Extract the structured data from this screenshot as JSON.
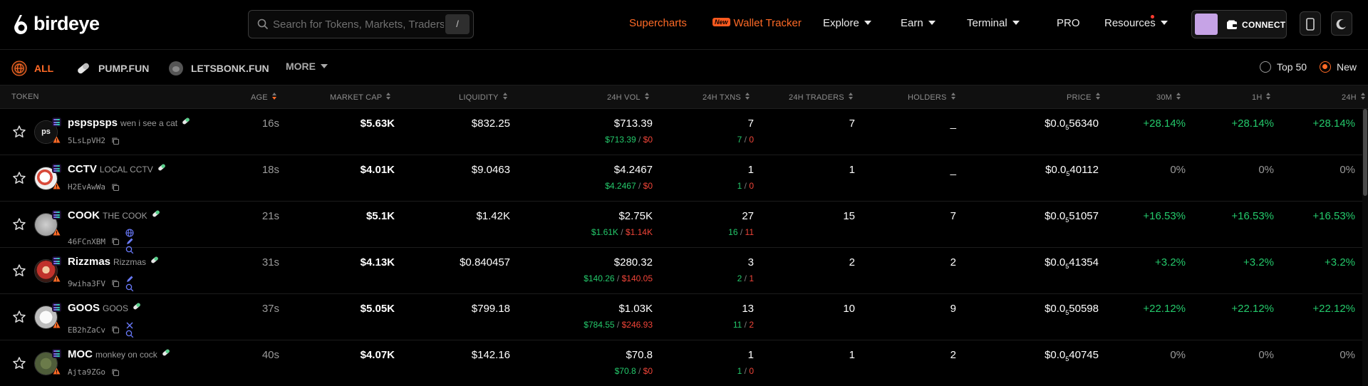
{
  "app": {
    "name": "birdeye"
  },
  "search": {
    "placeholder": "Search for Tokens, Markets, Traders...",
    "shortcut": "/"
  },
  "nav": {
    "supercharts": "Supercharts",
    "wallet_tracker_badge": "New",
    "wallet_tracker": "Wallet Tracker",
    "explore": "Explore",
    "earn": "Earn",
    "terminal": "Terminal",
    "pro": "PRO",
    "resources": "Resources",
    "connect": "CONNECT"
  },
  "filters": {
    "tabs": [
      {
        "label": "ALL",
        "active": true
      },
      {
        "label": "PUMP.FUN",
        "active": false
      },
      {
        "label": "LETSBONK.FUN",
        "active": false
      }
    ],
    "more": "MORE",
    "radio": [
      {
        "label": "Top 50",
        "selected": false
      },
      {
        "label": "New",
        "selected": true
      }
    ]
  },
  "colors": {
    "accent": "#ff6a26",
    "positive": "#24c96b",
    "negative": "#f04438"
  },
  "table": {
    "headers": {
      "token": "TOKEN",
      "age": "AGE",
      "market_cap": "MARKET CAP",
      "liquidity": "LIQUIDITY",
      "vol": "24H VOL",
      "txns": "24H TXNS",
      "traders": "24H TRADERS",
      "holders": "HOLDERS",
      "price": "PRICE",
      "m30": "30M",
      "h1": "1H",
      "h24": "24H"
    },
    "rows": [
      {
        "symbol": "pspspsps",
        "name": "wen i see a cat",
        "address": "5LsLpVH2",
        "age": "16s",
        "market_cap": "$5.63K",
        "liquidity": "$832.25",
        "vol": "$713.39",
        "vol_buy": "$713.39",
        "vol_sell": "$0",
        "txns": "7",
        "txns_buy": "7",
        "txns_sell": "0",
        "traders": "7",
        "holders": "_",
        "price_prefix": "$0.0",
        "price_zeros": "5",
        "price_digits": "56340",
        "m30": "+28.14%",
        "h1": "+28.14%",
        "h24": "+28.14%",
        "change_color": "positive"
      },
      {
        "symbol": "CCTV",
        "name": "LOCAL CCTV",
        "address": "H2EvAwWa",
        "age": "18s",
        "market_cap": "$4.01K",
        "liquidity": "$9.0463",
        "vol": "$4.2467",
        "vol_buy": "$4.2467",
        "vol_sell": "$0",
        "txns": "1",
        "txns_buy": "1",
        "txns_sell": "0",
        "traders": "1",
        "holders": "_",
        "price_prefix": "$0.0",
        "price_zeros": "5",
        "price_digits": "40112",
        "m30": "0%",
        "h1": "0%",
        "h24": "0%",
        "change_color": "neutral"
      },
      {
        "symbol": "COOK",
        "name": "THE COOK",
        "address": "46FCnXBM",
        "age": "21s",
        "market_cap": "$5.1K",
        "liquidity": "$1.42K",
        "vol": "$2.75K",
        "vol_buy": "$1.61K",
        "vol_sell": "$1.14K",
        "txns": "27",
        "txns_buy": "16",
        "txns_sell": "11",
        "traders": "15",
        "holders": "7",
        "price_prefix": "$0.0",
        "price_zeros": "5",
        "price_digits": "51057",
        "m30": "+16.53%",
        "h1": "+16.53%",
        "h24": "+16.53%",
        "change_color": "positive"
      },
      {
        "symbol": "Rizzmas",
        "name": "Rizzmas",
        "address": "9wiha3FV",
        "age": "31s",
        "market_cap": "$4.13K",
        "liquidity": "$0.840457",
        "vol": "$280.32",
        "vol_buy": "$140.26",
        "vol_sell": "$140.05",
        "txns": "3",
        "txns_buy": "2",
        "txns_sell": "1",
        "traders": "2",
        "holders": "2",
        "price_prefix": "$0.0",
        "price_zeros": "5",
        "price_digits": "41354",
        "m30": "+3.2%",
        "h1": "+3.2%",
        "h24": "+3.2%",
        "change_color": "positive"
      },
      {
        "symbol": "GOOS",
        "name": "GOOS",
        "address": "EB2hZaCv",
        "age": "37s",
        "market_cap": "$5.05K",
        "liquidity": "$799.18",
        "vol": "$1.03K",
        "vol_buy": "$784.55",
        "vol_sell": "$246.93",
        "txns": "13",
        "txns_buy": "11",
        "txns_sell": "2",
        "traders": "10",
        "holders": "9",
        "price_prefix": "$0.0",
        "price_zeros": "5",
        "price_digits": "50598",
        "m30": "+22.12%",
        "h1": "+22.12%",
        "h24": "+22.12%",
        "change_color": "positive"
      },
      {
        "symbol": "MOC",
        "name": "monkey on cock",
        "address": "Ajta9ZGo",
        "age": "40s",
        "market_cap": "$4.07K",
        "liquidity": "$142.16",
        "vol": "$70.8",
        "vol_buy": "$70.8",
        "vol_sell": "$0",
        "txns": "1",
        "txns_buy": "1",
        "txns_sell": "0",
        "traders": "1",
        "holders": "2",
        "price_prefix": "$0.0",
        "price_zeros": "5",
        "price_digits": "40745",
        "m30": "0%",
        "h1": "0%",
        "h24": "0%",
        "change_color": "neutral"
      }
    ]
  }
}
